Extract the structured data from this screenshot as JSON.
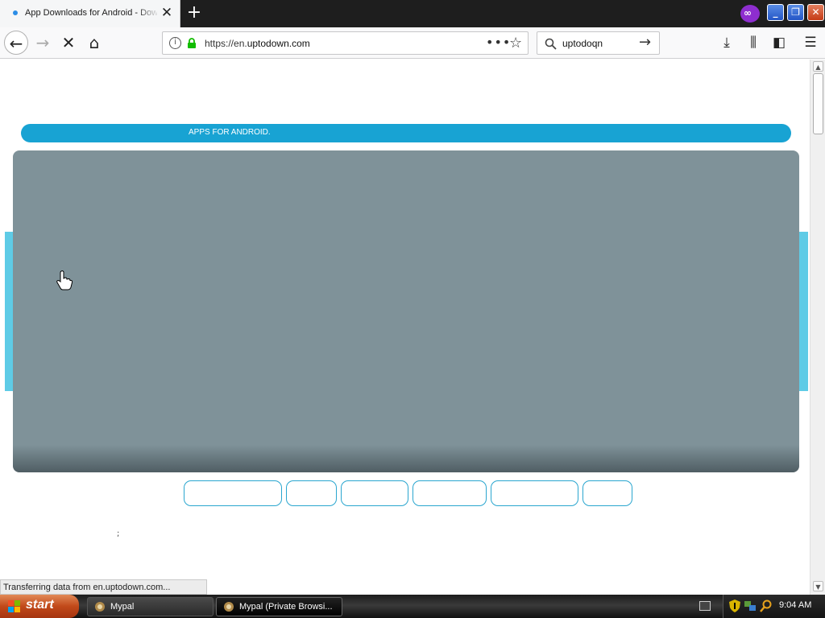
{
  "browser": {
    "tab": {
      "title": "App Downloads for Android - Download"
    },
    "url": {
      "prefix": "https://en.",
      "domain": "uptodown.com"
    },
    "search": {
      "value": "uptodoqn"
    }
  },
  "page": {
    "banner_text": "APPS FOR ANDROID.",
    "tiny_text": ";"
  },
  "status": {
    "text": "Transferring data from en.uptodown.com..."
  },
  "taskbar": {
    "start_label": "start",
    "tasks": [
      {
        "label": "Mypal"
      },
      {
        "label": "Mypal (Private Browsi..."
      }
    ],
    "clock": "9:04 AM"
  },
  "colors": {
    "accent": "#18a3d3",
    "hero": "#7f9299",
    "private": "#8e2ecf"
  }
}
